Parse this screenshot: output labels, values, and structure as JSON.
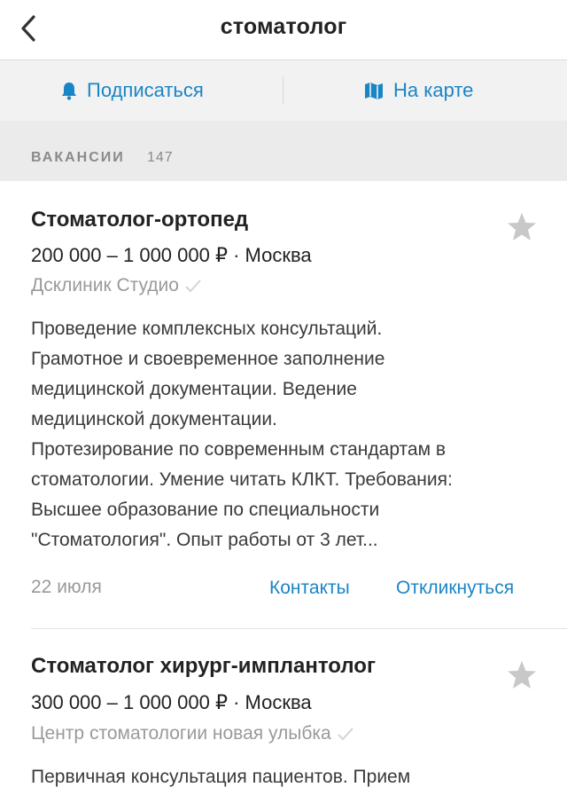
{
  "header": {
    "title": "стоматолог",
    "back_icon": "chevron-left-icon"
  },
  "actions": {
    "subscribe_label": "Подписаться",
    "subscribe_icon": "bell-icon",
    "map_label": "На карте",
    "map_icon": "map-icon"
  },
  "section": {
    "label": "ВАКАНСИИ",
    "count": "147"
  },
  "colors": {
    "accent": "#1a85c6",
    "muted": "#9a9a9a",
    "section_bg": "#ebebeb",
    "actions_bg": "#f2f2f2"
  },
  "vacancies": [
    {
      "title": "Стоматолог-ортопед",
      "salary": "200 000 – 1 000 000 ₽ · Москва",
      "company": "Дсклиник Студио",
      "description": [
        "Проведение комплексных консультаций.",
        "Грамотное и своевременное заполнение",
        "медицинской документации. Ведение",
        "медицинской документации.",
        "Протезирование по современным стандартам в",
        "стоматологии. Умение читать КЛКТ. Требования:",
        "Высшее образование по специальности",
        "\"Стоматология\". Опыт работы от 3 лет..."
      ],
      "date": "22 июля",
      "contacts_label": "Контакты",
      "respond_label": "Откликнуться"
    },
    {
      "title": "Стоматолог хирург-имплантолог",
      "salary": "300 000 – 1 000 000 ₽ · Москва",
      "company": "Центр стоматологии новая улыбка",
      "description": [
        "Первичная консультация пациентов. Прием"
      ]
    }
  ]
}
